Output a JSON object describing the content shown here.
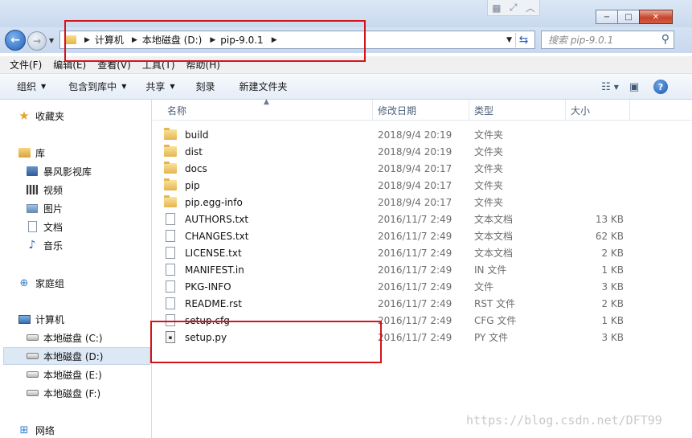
{
  "window": {
    "snap_icons": [
      "grid-icon",
      "maximize-arrows-icon",
      "chevron-up-icon"
    ],
    "buttons": {
      "minimize": "−",
      "maximize": "□",
      "close": "✕"
    }
  },
  "address_bar": {
    "crumbs": [
      "计算机",
      "本地磁盘 (D:)",
      "pip-9.0.1"
    ]
  },
  "search": {
    "placeholder": "搜索 pip-9.0.1"
  },
  "menu": [
    "文件(F)",
    "编辑(E)",
    "查看(V)",
    "工具(T)",
    "帮助(H)"
  ],
  "toolbar": {
    "organize": "组织",
    "include_in_library": "包含到库中",
    "share": "共享",
    "burn": "刻录",
    "new_folder": "新建文件夹"
  },
  "nav": {
    "favorites": "收藏夹",
    "libraries": "库",
    "lib_items": [
      "暴风影视库",
      "视频",
      "图片",
      "文档",
      "音乐"
    ],
    "homegroup": "家庭组",
    "computer": "计算机",
    "drives": [
      "本地磁盘 (C:)",
      "本地磁盘 (D:)",
      "本地磁盘 (E:)",
      "本地磁盘 (F:)"
    ],
    "network": "网络"
  },
  "columns": {
    "name": "名称",
    "date": "修改日期",
    "type": "类型",
    "size": "大小"
  },
  "files": [
    {
      "name": "build",
      "date": "2018/9/4 20:19",
      "type": "文件夹",
      "size": "",
      "kind": "folder"
    },
    {
      "name": "dist",
      "date": "2018/9/4 20:19",
      "type": "文件夹",
      "size": "",
      "kind": "folder"
    },
    {
      "name": "docs",
      "date": "2018/9/4 20:17",
      "type": "文件夹",
      "size": "",
      "kind": "folder"
    },
    {
      "name": "pip",
      "date": "2018/9/4 20:17",
      "type": "文件夹",
      "size": "",
      "kind": "folder"
    },
    {
      "name": "pip.egg-info",
      "date": "2018/9/4 20:17",
      "type": "文件夹",
      "size": "",
      "kind": "folder"
    },
    {
      "name": "AUTHORS.txt",
      "date": "2016/11/7 2:49",
      "type": "文本文档",
      "size": "13 KB",
      "kind": "file"
    },
    {
      "name": "CHANGES.txt",
      "date": "2016/11/7 2:49",
      "type": "文本文档",
      "size": "62 KB",
      "kind": "file"
    },
    {
      "name": "LICENSE.txt",
      "date": "2016/11/7 2:49",
      "type": "文本文档",
      "size": "2 KB",
      "kind": "file"
    },
    {
      "name": "MANIFEST.in",
      "date": "2016/11/7 2:49",
      "type": "IN 文件",
      "size": "1 KB",
      "kind": "file"
    },
    {
      "name": "PKG-INFO",
      "date": "2016/11/7 2:49",
      "type": "文件",
      "size": "3 KB",
      "kind": "file"
    },
    {
      "name": "README.rst",
      "date": "2016/11/7 2:49",
      "type": "RST 文件",
      "size": "2 KB",
      "kind": "file"
    },
    {
      "name": "setup.cfg",
      "date": "2016/11/7 2:49",
      "type": "CFG 文件",
      "size": "1 KB",
      "kind": "file"
    },
    {
      "name": "setup.py",
      "date": "2016/11/7 2:49",
      "type": "PY 文件",
      "size": "3 KB",
      "kind": "py"
    }
  ],
  "watermark": "https://blog.csdn.net/DFT99",
  "colors": {
    "annotation": "#d4141b",
    "selection": "#dde8f5"
  }
}
